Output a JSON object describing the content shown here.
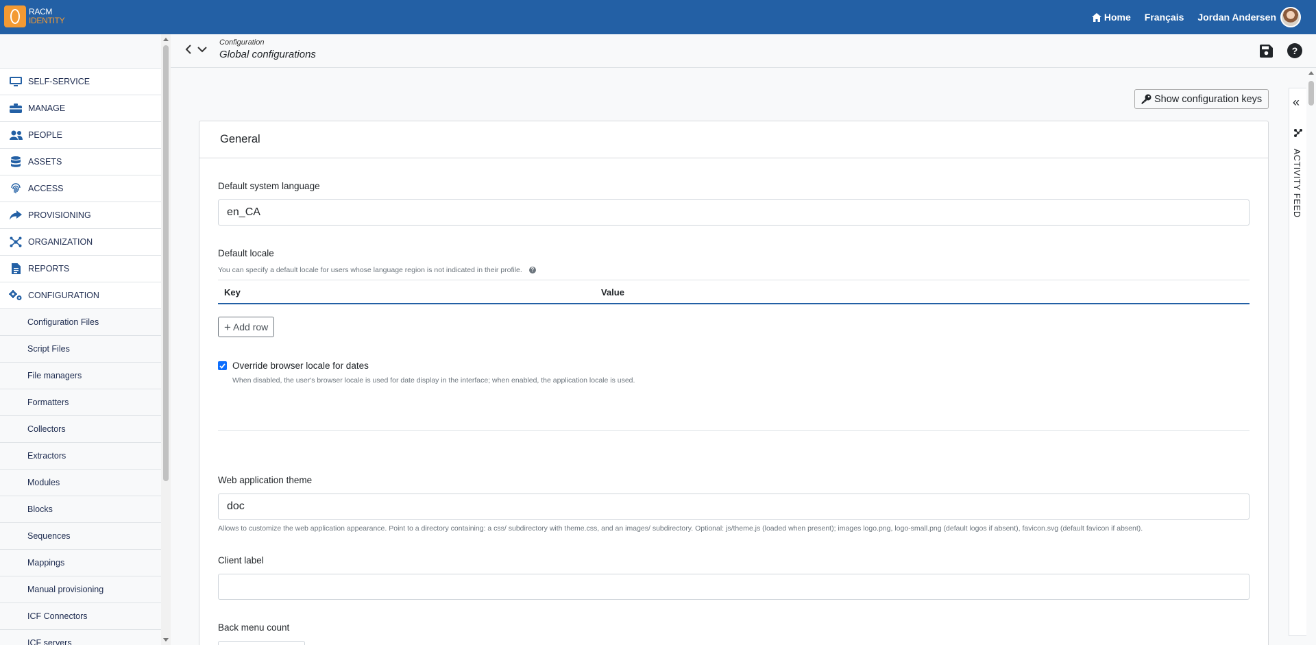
{
  "brand": {
    "line1": "RACM",
    "line2": "IDENTITY"
  },
  "topnav": {
    "home": "Home",
    "language": "Français",
    "user": "Jordan Andersen"
  },
  "sidebar": {
    "items": [
      {
        "label": "SELF-SERVICE",
        "icon": "monitor-icon"
      },
      {
        "label": "MANAGE",
        "icon": "toolbox-icon"
      },
      {
        "label": "PEOPLE",
        "icon": "users-icon"
      },
      {
        "label": "ASSETS",
        "icon": "database-icon"
      },
      {
        "label": "ACCESS",
        "icon": "fingerprint-icon"
      },
      {
        "label": "PROVISIONING",
        "icon": "share-icon"
      },
      {
        "label": "ORGANIZATION",
        "icon": "network-icon"
      },
      {
        "label": "REPORTS",
        "icon": "file-icon"
      },
      {
        "label": "CONFIGURATION",
        "icon": "cogs-icon"
      }
    ],
    "subitems": [
      "Configuration Files",
      "Script Files",
      "File managers",
      "Formatters",
      "Collectors",
      "Extractors",
      "Modules",
      "Blocks",
      "Sequences",
      "Mappings",
      "Manual provisioning",
      "ICF Connectors",
      "ICF servers"
    ]
  },
  "header": {
    "breadcrumb": "Configuration",
    "title": "Global configurations"
  },
  "actions": {
    "show_keys": "Show configuration keys"
  },
  "activity_feed": {
    "label": "ACTIVITY FEED"
  },
  "card": {
    "title": "General",
    "default_language": {
      "label": "Default system language",
      "value": "en_CA"
    },
    "default_locale": {
      "label": "Default locale",
      "hint": "You can specify a default locale for users whose language region is not indicated in their profile.",
      "columns": {
        "key": "Key",
        "value": "Value"
      },
      "add_row": "Add row"
    },
    "override_locale": {
      "label": "Override browser locale for dates",
      "checked": true,
      "hint": "When disabled, the user's browser locale is used for date display in the interface; when enabled, the application locale is used."
    },
    "theme": {
      "label": "Web application theme",
      "value": "doc",
      "hint": "Allows to customize the web application appearance. Point to a directory containing: a css/ subdirectory with theme.css, and an images/ subdirectory. Optional: js/theme.js (loaded when present); images logo.png, logo-small.png (default logos if absent), favicon.svg (default favicon if absent)."
    },
    "client_label": {
      "label": "Client label",
      "value": ""
    },
    "back_menu_count": {
      "label": "Back menu count"
    }
  }
}
